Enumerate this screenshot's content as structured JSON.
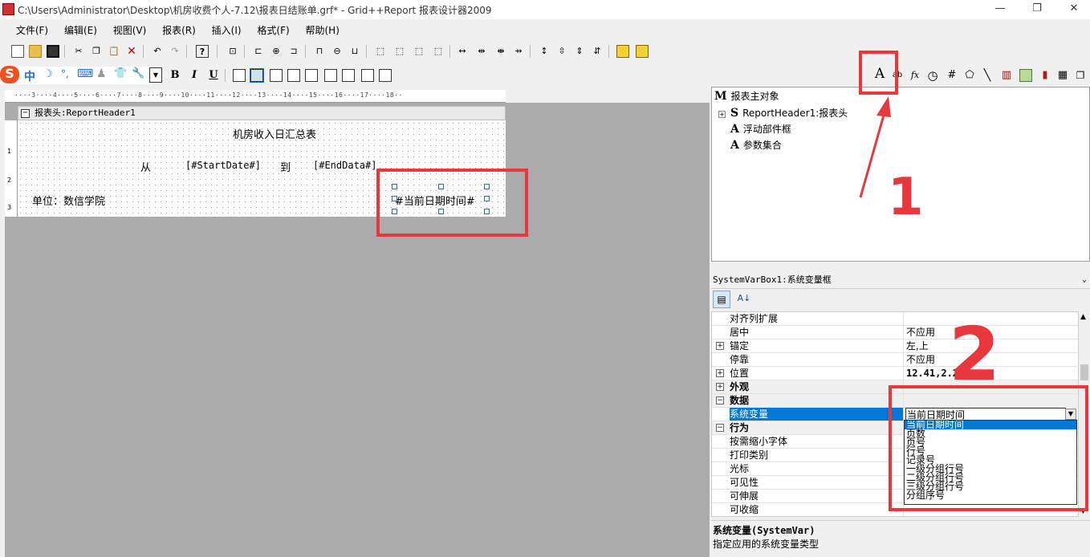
{
  "window": {
    "title": "C:\\Users\\Administrator\\Desktop\\机房收费个人-7.12\\报表日结账单.grf* - Grid++Report 报表设计器2009",
    "minimize": "—",
    "restore": "❐",
    "close": "✕"
  },
  "menu": [
    "文件(F)",
    "编辑(E)",
    "视图(V)",
    "报表(R)",
    "插入(I)",
    "格式(F)",
    "帮助(H)"
  ],
  "format_toolbar": {
    "bold": "B",
    "italic": "I",
    "underline": "U",
    "ime": [
      "S",
      "中",
      "☽",
      "°,",
      "⌨",
      "♟",
      "👕",
      "🔧"
    ]
  },
  "insert_toolbar": {
    "label_tool": "A",
    "text_tool": "ab",
    "fx_tool": "fx"
  },
  "section": {
    "header": "报表头:ReportHeader1"
  },
  "canvas": {
    "title": "机房收入日汇总表",
    "from": "从",
    "start": "[#StartDate#]",
    "to": "到",
    "end": "[#EndData#]",
    "unit": "单位：数信学院",
    "sysvar": "#当前日期时间#"
  },
  "tree": {
    "root": "报表主对象",
    "root_icon": "M",
    "items": [
      {
        "icon": "S",
        "label": "ReportHeader1:报表头"
      },
      {
        "icon": "A",
        "label": "浮动部件框"
      },
      {
        "icon": "A",
        "label": "参数集合"
      }
    ]
  },
  "props": {
    "selected_object": "SystemVarBox1:系统变量框",
    "rows": [
      {
        "name": "对齐列扩展",
        "value": ""
      },
      {
        "name": "居中",
        "value": "不应用"
      },
      {
        "name": "锚定",
        "value": "左,上",
        "expand": "+"
      },
      {
        "name": "停靠",
        "value": "不应用"
      },
      {
        "name": "位置",
        "value": "12.41,2.2",
        "expand": "+"
      },
      {
        "name": "外观",
        "value": "",
        "expand": "+",
        "category": true
      },
      {
        "name": "数据",
        "value": "",
        "expand": "−",
        "category": true
      },
      {
        "name": "系统变量",
        "value": "当前日期时间",
        "selected": true
      },
      {
        "name": "行为",
        "value": "",
        "expand": "−",
        "category": true
      },
      {
        "name": "按需缩小字体",
        "value": ""
      },
      {
        "name": "打印类别",
        "value": ""
      },
      {
        "name": "光标",
        "value": ""
      },
      {
        "name": "可见性",
        "value": ""
      },
      {
        "name": "可伸展",
        "value": ""
      },
      {
        "name": "可收缩",
        "value": ""
      }
    ],
    "dropdown_options": [
      "当前日期时间",
      "页数",
      "页号",
      "行号",
      "记录号",
      "一级分组行号",
      "二级分组行号",
      "三级分组行号",
      "分组序号"
    ]
  },
  "description": {
    "title": "系统变量(SystemVar)",
    "text": "指定应用的系统变量类型"
  },
  "annotations": {
    "one": "1",
    "two": "2"
  },
  "colors": {
    "annotation": "#e8383d",
    "selection": "#0078d7"
  }
}
